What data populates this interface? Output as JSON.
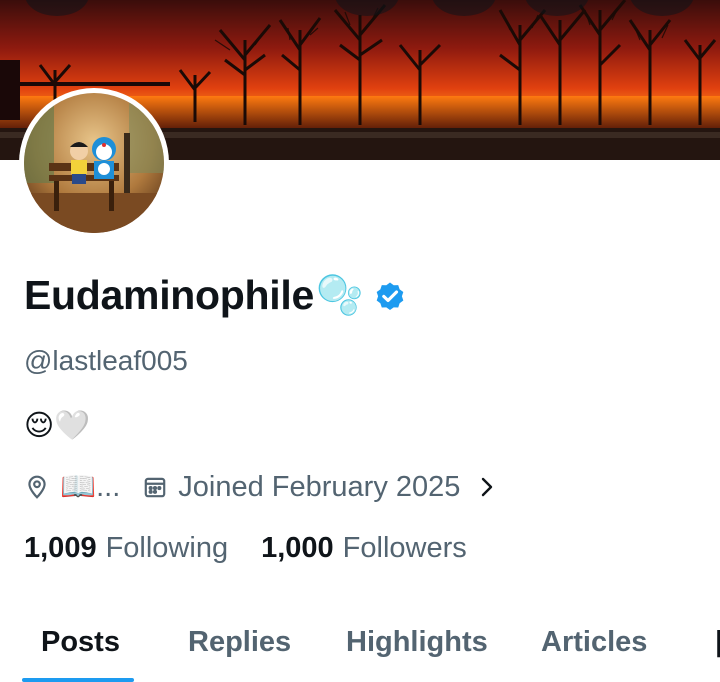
{
  "profile": {
    "display_name": "Eudaminophile",
    "name_emoji": "🫧",
    "handle": "@lastleaf005",
    "bio": "😌🤍",
    "location": "📖...",
    "joined": "Joined February 2025",
    "verified": true
  },
  "stats": {
    "following_count": "1,009",
    "following_label": "Following",
    "followers_count": "1,000",
    "followers_label": "Followers"
  },
  "tabs": [
    {
      "label": "Posts",
      "active": true
    },
    {
      "label": "Replies",
      "active": false
    },
    {
      "label": "Highlights",
      "active": false
    },
    {
      "label": "Articles",
      "active": false
    }
  ],
  "colors": {
    "accent": "#1d9bf0",
    "text": "#0f1419",
    "secondary": "#536471",
    "verified_badge": "#1d9bf0"
  },
  "icons": {
    "location": "map-pin-icon",
    "joined": "calendar-icon",
    "more": "chevron-right-icon",
    "verified": "verified-badge-icon"
  }
}
